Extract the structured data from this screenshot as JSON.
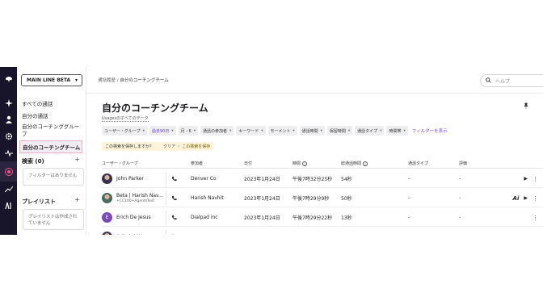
{
  "sidebar": {
    "workspace": "MAIN LINE BETA",
    "items": [
      {
        "label": "すべての通話"
      },
      {
        "label": "自分の通話"
      },
      {
        "label": "自分のコーチンググループ"
      },
      {
        "label": "自分のコーチングチーム"
      }
    ],
    "search_section": "検索 (0)",
    "search_empty": "フィルターはありません",
    "playlist_section": "プレイリスト",
    "playlist_empty": "プレイリストは作成されていません"
  },
  "topbar": {
    "breadcrumb_parent": "通話履歴",
    "breadcrumb_sep": " / ",
    "breadcrumb_current": "自分のコーチングチーム",
    "search_placeholder": "ヘルプ"
  },
  "main": {
    "title": "自分のコーチングチーム",
    "subtitle": "Usagesのすべてのデータ",
    "filters": [
      {
        "label": "ユーザー・グループ",
        "highlight": false
      },
      {
        "label": "過去90日",
        "highlight": true
      },
      {
        "label": "月 - 6",
        "highlight": false
      },
      {
        "label": "通話の参加者",
        "highlight": false
      },
      {
        "label": "キーワード",
        "highlight": false
      },
      {
        "label": "モーメント",
        "highlight": false
      },
      {
        "label": "通話時間",
        "highlight": false
      },
      {
        "label": "保留時間",
        "highlight": false
      },
      {
        "label": "通話タイプ",
        "highlight": false
      },
      {
        "label": "時間帯",
        "highlight": false
      }
    ],
    "show_filters": "フィルターを表示",
    "save_prompt": "この検索を保存しますか？",
    "clear_label": "クリア",
    "save_label": "この検索を保存",
    "columns": {
      "user": "ユーザー・グループ",
      "participant": "参加者",
      "date": "日付",
      "time": "時間",
      "duration": "総通話時間",
      "type": "通話タイプ",
      "rating": "評価"
    },
    "rows": [
      {
        "name": "John Parker",
        "sub": "",
        "participant": "Denver Co",
        "date": "2023年1月24日",
        "time": "午後7時32分25秒",
        "duration": "54秒",
        "type": "-",
        "rating": "-",
        "avatar": "photo",
        "play": "▶",
        "ai": ""
      },
      {
        "name": "Beta | Harish Nav...",
        "sub": "+CC100+AgentsTest",
        "participant": "Harish Navhit",
        "date": "2023年1月24日",
        "time": "午後7時29分9秒",
        "duration": "50秒",
        "type": "-",
        "rating": "-",
        "avatar": "photo",
        "play": "▶",
        "ai": "Ai"
      },
      {
        "name": "Erich De Jesus",
        "sub": "",
        "participant": "Dialpad inc",
        "date": "2023年1月24日",
        "time": "午後7時29分22秒",
        "duration": "13秒",
        "type": "-",
        "rating": "-",
        "avatar": "E",
        "play": "",
        "ai": ""
      },
      {
        "name": "Ashwini V",
        "sub": "",
        "participant": "",
        "date": "",
        "time": "",
        "duration": "",
        "type": "",
        "rating": "",
        "avatar": "photo",
        "play": "",
        "ai": ""
      }
    ]
  },
  "colors": {
    "rail": "#18152a",
    "accent": "#7c4dff",
    "selected_border": "#e3b3c3",
    "save_banner": "#fdf4db"
  },
  "icons": [
    "dialpad-logo-icon",
    "sparkle-icon",
    "user-icon",
    "gear-icon",
    "activity-icon",
    "coaching-target-icon",
    "trend-icon",
    "ai-icon",
    "search-icon",
    "pin-icon",
    "phone-icon",
    "play-icon",
    "more-icon",
    "info-icon"
  ]
}
